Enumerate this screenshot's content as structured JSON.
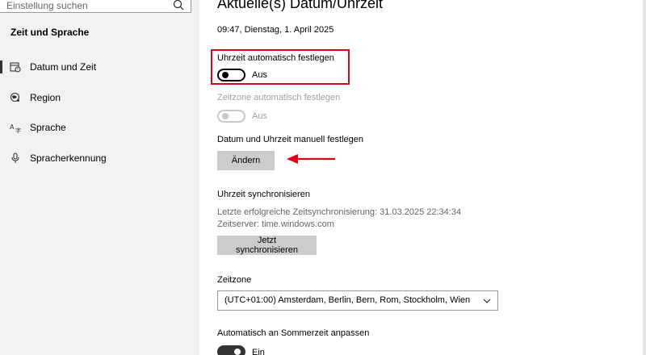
{
  "sidebar": {
    "search_placeholder": "Einstellung suchen",
    "section_title": "Zeit und Sprache",
    "items": [
      {
        "label": "Datum und Zeit",
        "icon": "calendar-clock-icon",
        "selected": true
      },
      {
        "label": "Region",
        "icon": "globe-pin-icon",
        "selected": false
      },
      {
        "label": "Sprache",
        "icon": "language-icon",
        "selected": false
      },
      {
        "label": "Spracherkennung",
        "icon": "microphone-icon",
        "selected": false
      }
    ]
  },
  "main": {
    "title": "Aktuelle(s) Datum/Uhrzeit",
    "datetime": "09:47, Dienstag, 1. April 2025",
    "auto_time": {
      "label": "Uhrzeit automatisch festlegen",
      "state": "Aus"
    },
    "auto_zone": {
      "label": "Zeitzone automatisch festlegen",
      "state": "Aus"
    },
    "manual": {
      "label": "Datum und Uhrzeit manuell festlegen",
      "button": "Ändern"
    },
    "sync": {
      "heading": "Uhrzeit synchronisieren",
      "last": "Letzte erfolgreiche Zeitsynchronisierung: 31.03.2025 22:34:34",
      "server": "Zeitserver: time.windows.com",
      "button": "Jetzt synchronisieren"
    },
    "timezone": {
      "label": "Zeitzone",
      "value": "(UTC+01:00) Amsterdam, Berlin, Bern, Rom, Stockholm, Wien"
    },
    "dst": {
      "label": "Automatisch an Sommerzeit anpassen",
      "state": "Ein"
    }
  },
  "colors": {
    "annotation_red": "#e0001b",
    "toggle_dark": "#333333"
  }
}
